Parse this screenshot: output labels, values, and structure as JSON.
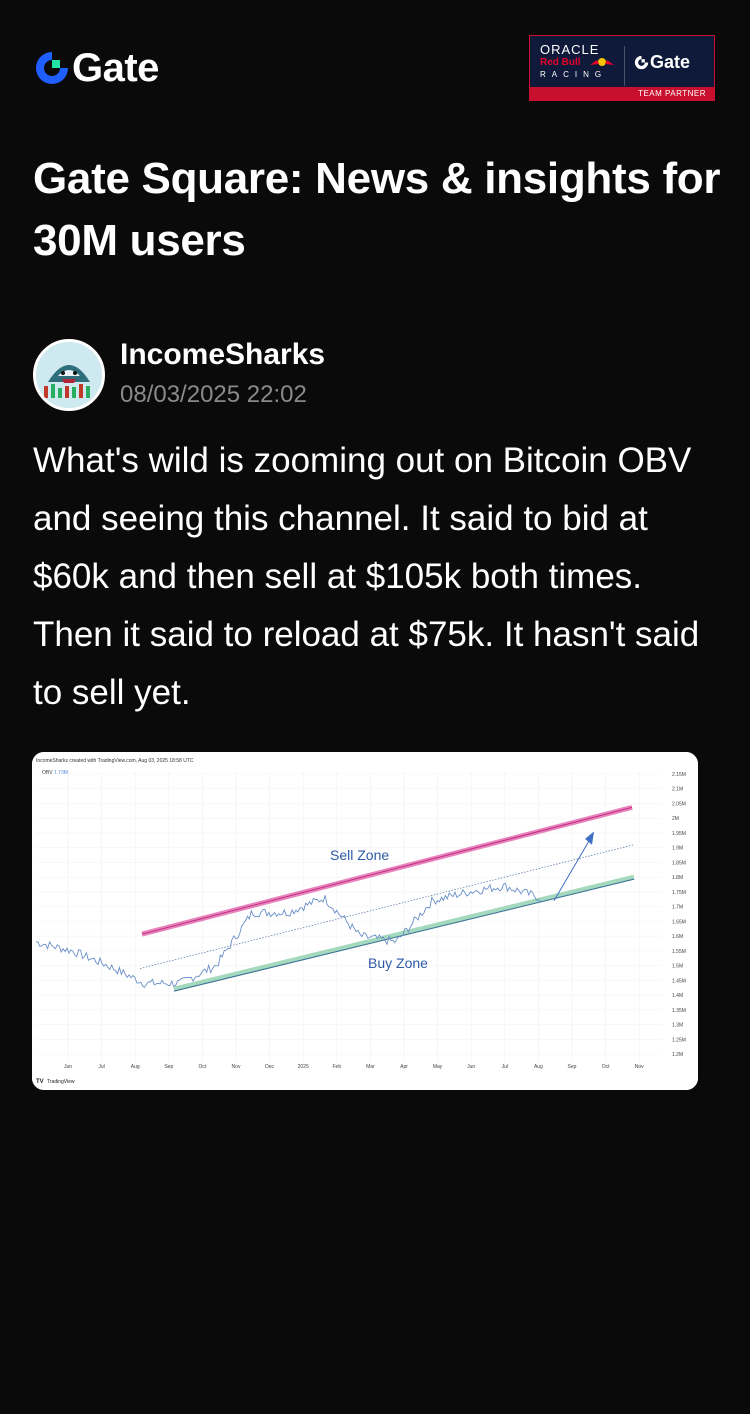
{
  "header": {
    "logo_text": "Gate",
    "partner": {
      "oracle": "ORACLE",
      "redbull": "Red Bull",
      "racing": "RACING",
      "gate": "Gate",
      "team_partner": "TEAM PARTNER"
    }
  },
  "page": {
    "title": "Gate Square: News & insights for 30M users"
  },
  "post": {
    "author": "IncomeSharks",
    "timestamp": "08/03/2025 22:02",
    "body": "What's wild is zooming out on Bitcoin OBV and seeing this channel. It said to bid at $60k and then sell at $105k both times. Then it said to reload at $75k. It hasn't said to sell yet."
  },
  "chart": {
    "credit": "IncomeSharks created with TradingView.com, Aug 03, 2025 18:58 UTC",
    "indicator": "OBV",
    "indicator_value": "1.73M",
    "sell_zone": "Sell Zone",
    "buy_zone": "Buy Zone",
    "watermark": "TradingView",
    "x_ticks": [
      "Jun",
      "Jul",
      "Aug",
      "Sep",
      "Oct",
      "Nov",
      "Dec",
      "2025",
      "Feb",
      "Mar",
      "Apr",
      "May",
      "Jun",
      "Jul",
      "Aug",
      "Sep",
      "Oct",
      "Nov"
    ],
    "y_ticks": [
      "2.15M",
      "2.1M",
      "2.05M",
      "2M",
      "1.95M",
      "1.9M",
      "1.85M",
      "1.8M",
      "1.75M",
      "1.7M",
      "1.65M",
      "1.6M",
      "1.55M",
      "1.5M",
      "1.45M",
      "1.4M",
      "1.35M",
      "1.3M",
      "1.25M",
      "1.2M"
    ],
    "colors": {
      "line": "#6b8fc9",
      "sell_band": "#e05aa8",
      "buy_band": "#8fcfae",
      "zone_text": "#2e5aa8"
    }
  },
  "chart_data": {
    "type": "line",
    "title": "",
    "ylabel": "",
    "xlabel": "",
    "ylim": [
      1.2,
      2.15
    ],
    "series": [
      {
        "name": "OBV",
        "x": [
          "Jun",
          "Jul",
          "Aug",
          "Sep",
          "Oct",
          "Nov",
          "Dec",
          "2025",
          "Feb",
          "Mar",
          "Apr",
          "May",
          "Jun",
          "Jul",
          "Aug"
        ],
        "values": [
          1.58,
          1.55,
          1.5,
          1.44,
          1.44,
          1.5,
          1.68,
          1.68,
          1.73,
          1.6,
          1.58,
          1.72,
          1.75,
          1.77,
          1.73
        ]
      }
    ]
  }
}
